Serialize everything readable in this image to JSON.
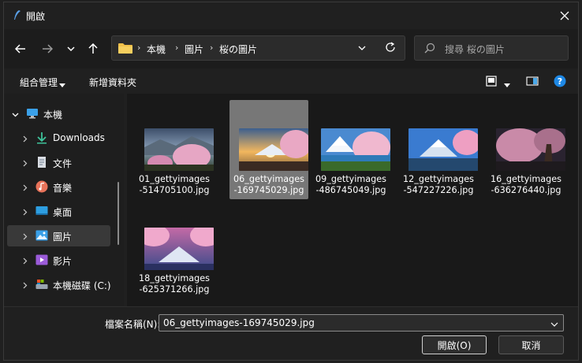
{
  "title": "開啟",
  "address": {
    "crumbs": [
      "本機",
      "圖片",
      "桜の圖片"
    ]
  },
  "search": {
    "placeholder": "搜尋 桜の圖片"
  },
  "toolbar": {
    "organize_label": "組合管理",
    "new_folder_label": "新增資料夾"
  },
  "sidebar": {
    "items": [
      {
        "label": "本機",
        "icon": "computer-icon"
      },
      {
        "label": "Downloads",
        "icon": "download-icon"
      },
      {
        "label": "文件",
        "icon": "document-icon"
      },
      {
        "label": "音樂",
        "icon": "music-icon"
      },
      {
        "label": "桌面",
        "icon": "desktop-icon"
      },
      {
        "label": "圖片",
        "icon": "pictures-icon",
        "selected": true
      },
      {
        "label": "影片",
        "icon": "video-icon"
      },
      {
        "label": "本機磁碟 (C:)",
        "icon": "drive-icon"
      }
    ]
  },
  "files": [
    {
      "line1": "01_gettyimages",
      "line2": "-514705100.jpg"
    },
    {
      "line1": "06_gettyimages",
      "line2": "-169745029.jpg",
      "selected": true
    },
    {
      "line1": "09_gettyimages",
      "line2": "-486745049.jpg"
    },
    {
      "line1": "12_gettyimages",
      "line2": "-547227226.jpg"
    },
    {
      "line1": "16_gettyimages",
      "line2": "-636276440.jpg"
    },
    {
      "line1": "18_gettyimages",
      "line2": "-625371266.jpg"
    }
  ],
  "footer": {
    "filename_label": "檔案名稱(N):",
    "filename_value": "06_gettyimages-169745029.jpg",
    "open_label": "開啟(O)",
    "cancel_label": "取消"
  },
  "colors": {
    "accent": "#0078d4",
    "selection": "#777777",
    "folder": "#f0c04a"
  }
}
